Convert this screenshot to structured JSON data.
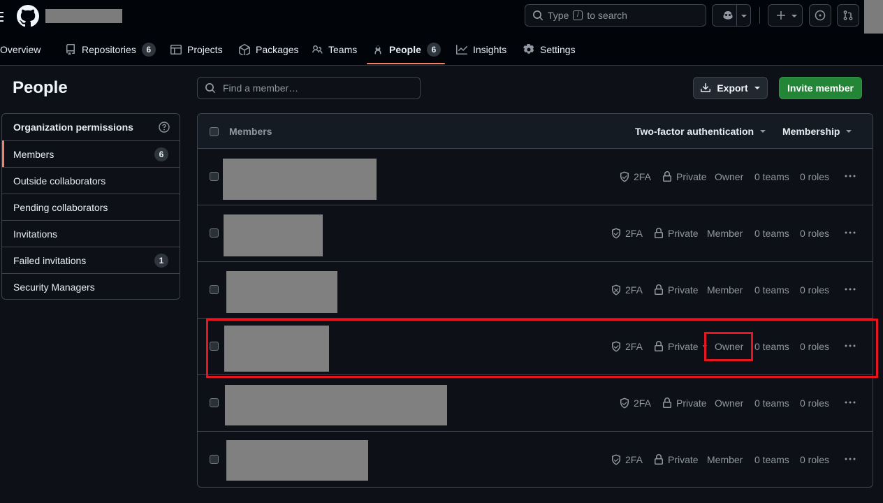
{
  "header": {
    "search": {
      "label_pre": "Type",
      "key": "/",
      "label_post": "to search"
    }
  },
  "nav": {
    "tabs": [
      {
        "label": "Overview"
      },
      {
        "label": "Repositories",
        "count": "6"
      },
      {
        "label": "Projects"
      },
      {
        "label": "Packages"
      },
      {
        "label": "Teams"
      },
      {
        "label": "People",
        "count": "6"
      },
      {
        "label": "Insights"
      },
      {
        "label": "Settings"
      }
    ]
  },
  "page": {
    "title": "People"
  },
  "sidebar": {
    "header": "Organization permissions",
    "items": [
      {
        "label": "Members",
        "count": "6"
      },
      {
        "label": "Outside collaborators"
      },
      {
        "label": "Pending collaborators"
      },
      {
        "label": "Invitations"
      },
      {
        "label": "Failed invitations",
        "count": "1"
      },
      {
        "label": "Security Managers"
      }
    ]
  },
  "toolbar": {
    "find_placeholder": "Find a member…",
    "export_label": "Export",
    "invite_label": "Invite member"
  },
  "table": {
    "header_members": "Members",
    "header_2fa": "Two-factor authentication",
    "header_membership": "Membership",
    "rows": [
      {
        "twofa": "2FA",
        "visibility": "Private",
        "role": "Owner",
        "teams": "0 teams",
        "roles": "0 roles"
      },
      {
        "twofa": "2FA",
        "visibility": "Private",
        "role": "Member",
        "teams": "0 teams",
        "roles": "0 roles"
      },
      {
        "twofa": "2FA",
        "visibility": "Private",
        "role": "Member",
        "teams": "0 teams",
        "roles": "0 roles"
      },
      {
        "twofa": "2FA",
        "visibility": "Private",
        "role": "Owner",
        "teams": "0 teams",
        "roles": "0 roles"
      },
      {
        "twofa": "2FA",
        "visibility": "Private",
        "role": "Owner",
        "teams": "0 teams",
        "roles": "0 roles"
      },
      {
        "twofa": "2FA",
        "visibility": "Private",
        "role": "Member",
        "teams": "0 teams",
        "roles": "0 roles"
      }
    ]
  },
  "colors": {
    "accent_underline": "#f78166",
    "primary_button": "#238636",
    "highlight": "#e8141e"
  }
}
